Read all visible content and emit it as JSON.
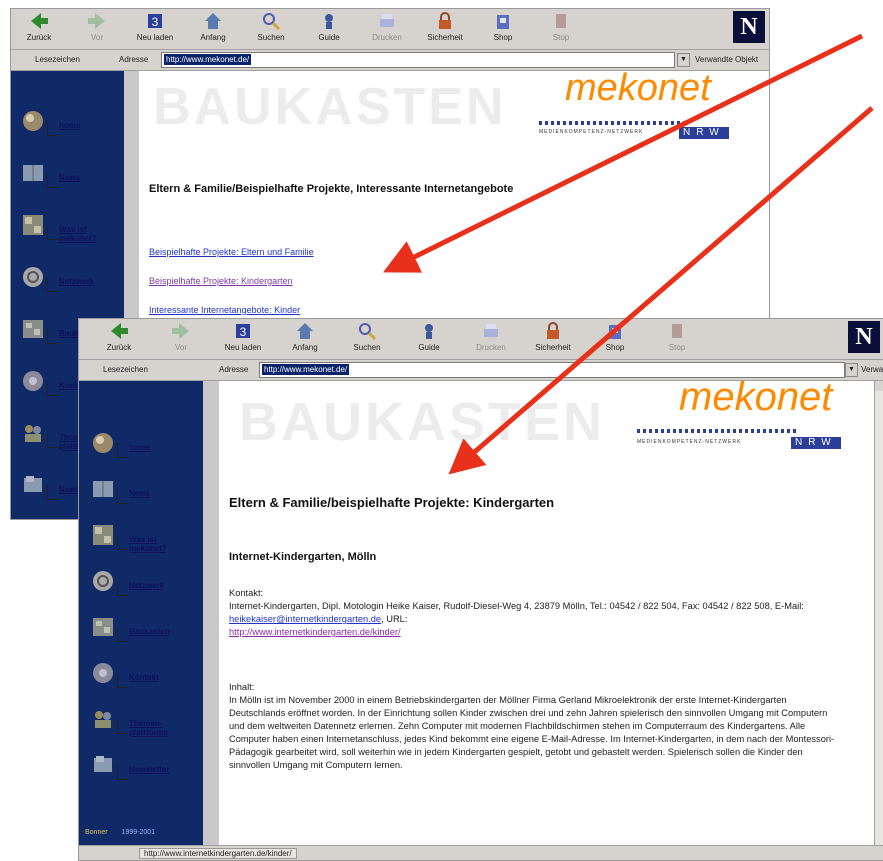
{
  "browser": {
    "toolbar": [
      {
        "key": "back",
        "label": "Zurück",
        "enabled": true,
        "icon": "back-arrow-icon"
      },
      {
        "key": "forward",
        "label": "Vor",
        "enabled": false,
        "icon": "forward-arrow-icon"
      },
      {
        "key": "reload",
        "label": "Neu laden",
        "enabled": true,
        "icon": "reload-icon"
      },
      {
        "key": "home",
        "label": "Anfang",
        "enabled": true,
        "icon": "home-icon"
      },
      {
        "key": "search",
        "label": "Suchen",
        "enabled": true,
        "icon": "search-icon"
      },
      {
        "key": "guide",
        "label": "Guide",
        "enabled": true,
        "icon": "guide-icon"
      },
      {
        "key": "print",
        "label": "Drucken",
        "enabled": false,
        "icon": "print-icon"
      },
      {
        "key": "security",
        "label": "Sicherheit",
        "enabled": true,
        "icon": "lock-icon"
      },
      {
        "key": "shop",
        "label": "Shop",
        "enabled": true,
        "icon": "shop-icon"
      },
      {
        "key": "stop",
        "label": "Stop",
        "enabled": false,
        "icon": "stop-icon"
      }
    ],
    "brand_logo": "N",
    "bookmarks_label": "Lesezeichen",
    "address_label": "Adresse",
    "url": "http://www.mekonet.de/",
    "related_label": "Verwandte Objekt"
  },
  "sidebar": {
    "items": [
      {
        "label": "home",
        "icon": "home-globe-icon"
      },
      {
        "label": "News",
        "icon": "news-book-icon"
      },
      {
        "label": "Was ist\nmekonet?",
        "icon": "info-grid-icon"
      },
      {
        "label": "Netzwerk",
        "icon": "network-globe-icon"
      },
      {
        "label": "Baukasten",
        "icon": "toolbox-icon"
      },
      {
        "label": "Kontakt",
        "icon": "contact-globe-icon"
      },
      {
        "label": "Themen-\nplattforme",
        "icon": "people-icon"
      },
      {
        "label": "Newsletter",
        "icon": "newsletter-icon"
      }
    ],
    "footer_label": "Bonner",
    "footer_years": "1999-2001"
  },
  "page": {
    "banner_text": "BAUKASTEN",
    "logo_text": "mekonet",
    "logo_sub": "MEDIENKOMPETENZ-NETZWERK",
    "logo_region": "NRW"
  },
  "window1": {
    "title": "Eltern & Familie/Beispielhafte Projekte, Interessante Internetangebote",
    "links": [
      {
        "text": "Beispielhafte Projekte: Eltern und Familie",
        "visited": false
      },
      {
        "text": "Beispielhafte Projekte: Kindergarten",
        "visited": true
      },
      {
        "text": "Interessante Internetangebote: Kinder",
        "visited": false
      }
    ]
  },
  "window2": {
    "title": "Eltern & Familie/beispielhafte Projekte: Kindergarten",
    "subtitle": "Internet-Kindergarten, Mölln",
    "contact_heading": "Kontakt:",
    "contact_text": "Internet-Kindergarten, Dipl. Motologin Heike Kaiser, Rudolf-Diesel-Weg 4, 23879 Mölln, Tel.: 04542 / 822 504, Fax: 04542 / 822 508, E-Mail: ",
    "contact_email": "heikekaiser@internetkindergarten.de",
    "contact_url_label": ", URL:",
    "contact_url": "http://www.internetkindergarten.de/kinder/",
    "info_heading": "Inhalt:",
    "info_text": "In Mölln ist im November 2000 in einem Betriebskindergarten der Möllner Firma Gerland Mikroelektronik der erste Internet-Kindergarten Deutschlands eröffnet worden. In der Einrichtung sollen Kinder zwischen drei und zehn Jahren spielerisch den sinnvollen Umgang mit Computern und dem weltweiten Datennetz erlernen. Zehn Computer mit modernen Flachbildschirmen stehen im Computerraum des Kindergartens. Alle Computer haben einen Internetanschluss, jedes Kind bekommt eine eigene E-Mail-Adresse. Im Internet-Kindergarten, in dem nach der Montessori-Pädagogik gearbeitet wird, soll weiterhin wie in jedem Kindergarten gespielt, getobt und gebastelt werden. Spielerisch sollen die Kinder den sinnvollen Umgang mit Computern lernen.",
    "status_text": "http://www.internetkindergarten.de/kinder/"
  },
  "colors": {
    "sidebar": "#0f2a66",
    "arrow": "#e8301a",
    "logo_orange": "#ff8a00",
    "link": "#2233cc",
    "visited_link": "#7d3aa0"
  }
}
